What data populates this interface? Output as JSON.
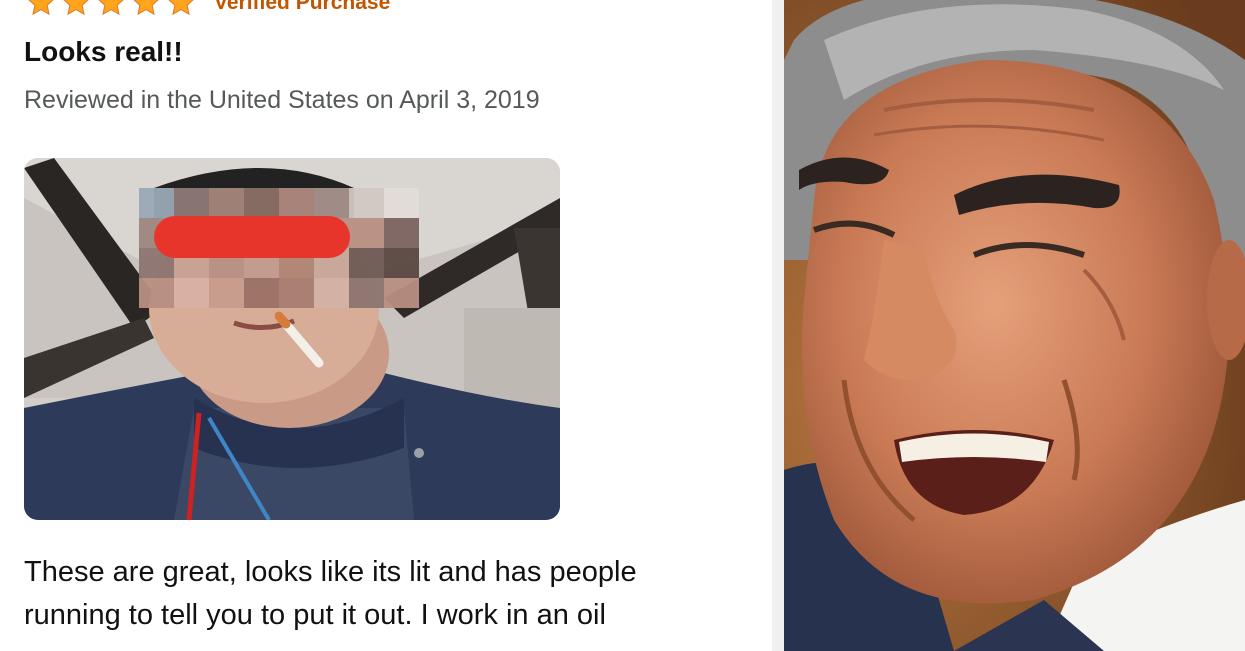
{
  "review": {
    "rating": 5,
    "rating_max": 5,
    "verified_label": "Verified Purchase",
    "title": "Looks real!!",
    "meta": "Reviewed in the United States on April 3, 2019",
    "body_lines": [
      "These are great, looks like its lit and has people",
      "running to tell you to put it out. I work in an oil"
    ]
  },
  "colors": {
    "star": "#ffa41c",
    "verified": "#c45500",
    "meta_text": "#565959",
    "redaction": "#e8352b"
  },
  "images": {
    "review_photo": "customer-selfie-with-cigarette",
    "reaction_photo": "laughing-man-reaction"
  }
}
